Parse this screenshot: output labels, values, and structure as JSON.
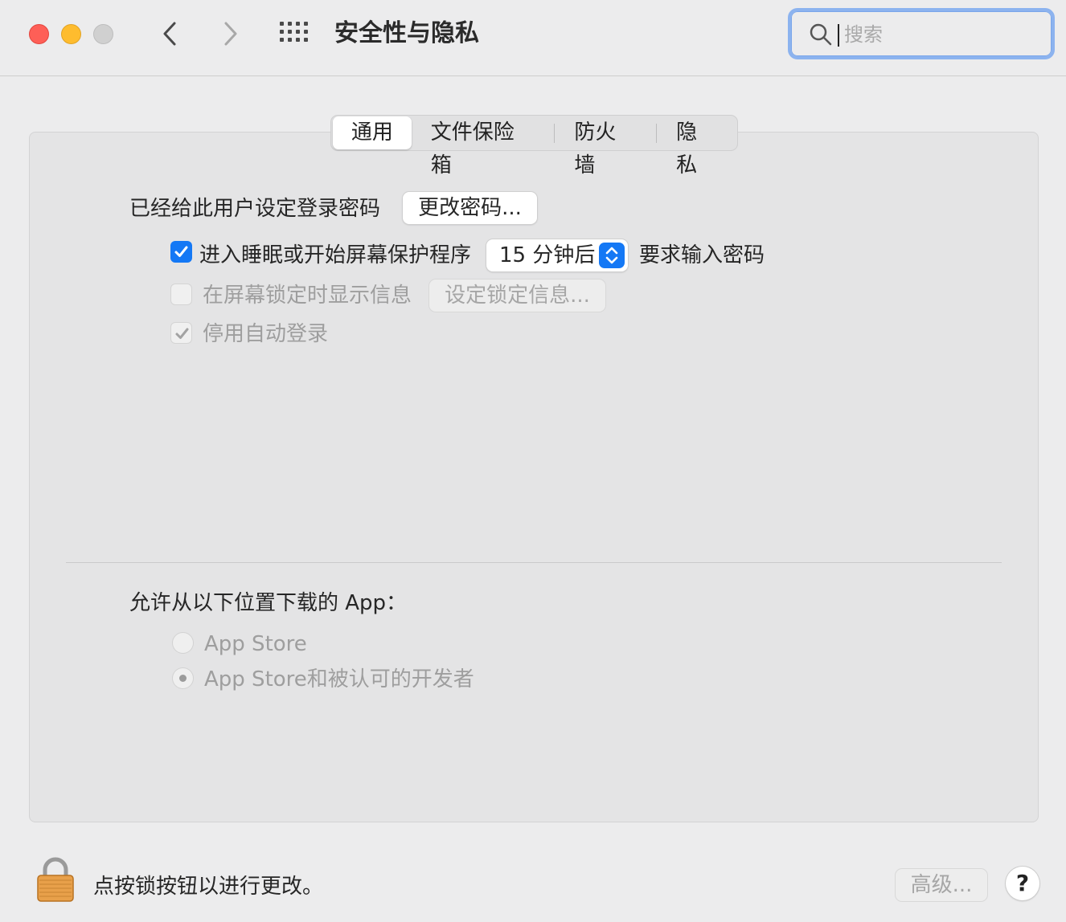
{
  "window": {
    "title": "安全性与隐私",
    "search_placeholder": "搜索"
  },
  "tabs": [
    {
      "label": "通用",
      "active": true
    },
    {
      "label": "文件保险箱",
      "active": false
    },
    {
      "label": "防火墙",
      "active": false
    },
    {
      "label": "隐私",
      "active": false
    }
  ],
  "general": {
    "password_set_text": "已经给此用户设定登录密码",
    "change_password_button": "更改密码...",
    "require_password": {
      "checked": true,
      "label_prefix": "进入睡眠或开始屏幕保护程序",
      "delay_value": "15 分钟后",
      "label_suffix": "要求输入密码"
    },
    "show_message": {
      "checked": false,
      "enabled": false,
      "label": "在屏幕锁定时显示信息",
      "button": "设定锁定信息..."
    },
    "disable_auto_login": {
      "checked": true,
      "enabled": false,
      "label": "停用自动登录"
    }
  },
  "download_section": {
    "heading": "允许从以下位置下载的 App：",
    "options": [
      {
        "label": "App Store",
        "selected": false
      },
      {
        "label": "App Store和被认可的开发者",
        "selected": true
      }
    ]
  },
  "footer": {
    "lock_text": "点按锁按钮以进行更改。",
    "advanced_button": "高级...",
    "help_button": "?"
  },
  "colors": {
    "accent": "#1478f5",
    "close": "#fe5f57",
    "minimize": "#febc2e",
    "lock_gold": "#e8a04a"
  }
}
